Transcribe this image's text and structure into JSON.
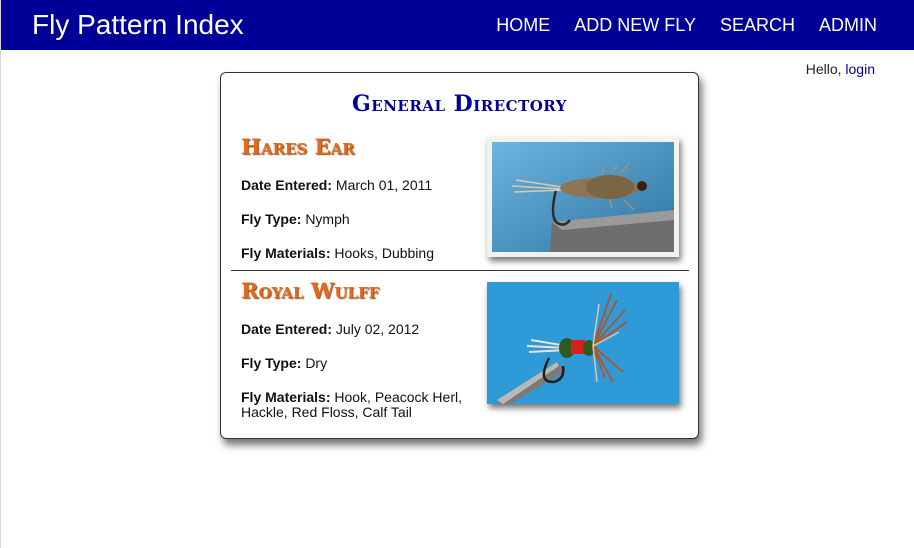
{
  "header": {
    "site_title": "Fly Pattern Index",
    "nav": [
      "HOME",
      "ADD NEW FLY",
      "SEARCH",
      "ADMIN"
    ]
  },
  "user": {
    "greeting": "Hello, ",
    "login_label": "login"
  },
  "directory": {
    "title": "General Directory",
    "labels": {
      "date": "Date Entered:",
      "type": "Fly Type:",
      "materials": "Fly Materials:"
    },
    "entries": [
      {
        "name": "Hares Ear",
        "date": "March 01, 2011",
        "type": "Nymph",
        "materials": "Hooks, Dubbing"
      },
      {
        "name": "Royal Wulff",
        "date": "July 02, 2012",
        "type": "Dry",
        "materials": "Hook, Peacock Herl, Hackle, Red Floss, Calf Tail"
      }
    ]
  },
  "colors": {
    "header_bg": "#000099",
    "title": "#000099",
    "fly_name": "#e06a1e",
    "photo_bg": "#3a9ad4"
  }
}
